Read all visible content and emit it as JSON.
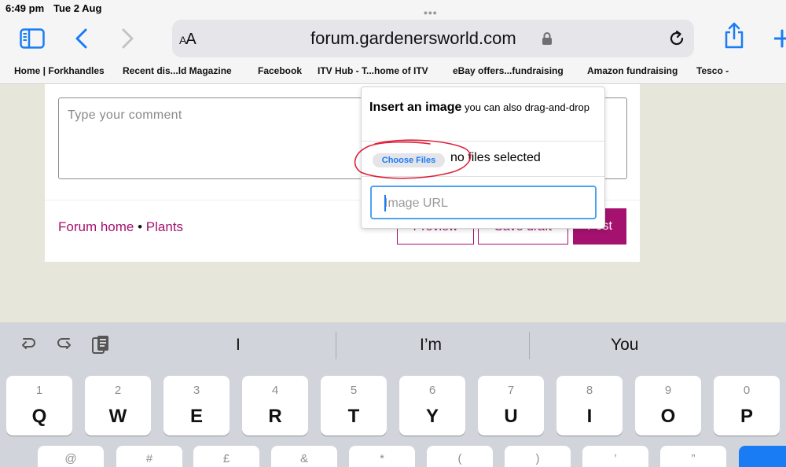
{
  "status": {
    "time": "6:49 pm",
    "date": "Tue 2 Aug"
  },
  "browser": {
    "multitask_dots": "•••",
    "reader_label_small": "A",
    "reader_label_large": "A",
    "url": "forum.gardenersworld.com",
    "icons": [
      "sidebar-icon",
      "back-icon",
      "forward-icon",
      "lock-icon",
      "reload-icon",
      "share-icon",
      "new-tab-icon"
    ],
    "accent_color": "#1a7cf5"
  },
  "bookmarks": [
    "Home | Forkhandles",
    "Recent dis...ld Magazine",
    "Facebook",
    "ITV Hub - T...home of ITV",
    "eBay offers...fundraising",
    "Amazon fundraising",
    "Tesco -"
  ],
  "comment": {
    "placeholder": "Type your comment"
  },
  "breadcrumb": {
    "home": "Forum home",
    "separator": "•",
    "section": "Plants"
  },
  "actions": {
    "preview": "Preview",
    "save_draft": "Save draft",
    "post": "Post",
    "brand_color": "#a4116f"
  },
  "insert_image": {
    "title": "Insert an image",
    "subtitle": "you can also drag-and-drop",
    "choose_button": "Choose Files",
    "file_status": "no files selected",
    "url_placeholder": "Image URL"
  },
  "keyboard": {
    "suggestions": [
      "I",
      "I’m",
      "You"
    ],
    "toolbar_icons": [
      "undo-icon",
      "redo-icon",
      "paste-icon"
    ],
    "row1": [
      {
        "num": "1",
        "ch": "Q"
      },
      {
        "num": "2",
        "ch": "W"
      },
      {
        "num": "3",
        "ch": "E"
      },
      {
        "num": "4",
        "ch": "R"
      },
      {
        "num": "5",
        "ch": "T"
      },
      {
        "num": "6",
        "ch": "Y"
      },
      {
        "num": "7",
        "ch": "U"
      },
      {
        "num": "8",
        "ch": "I"
      },
      {
        "num": "9",
        "ch": "O"
      },
      {
        "num": "0",
        "ch": "P"
      }
    ],
    "row2_symbols": [
      "@",
      "#",
      "£",
      "&",
      "*",
      "(",
      ")",
      "’",
      "”"
    ]
  }
}
